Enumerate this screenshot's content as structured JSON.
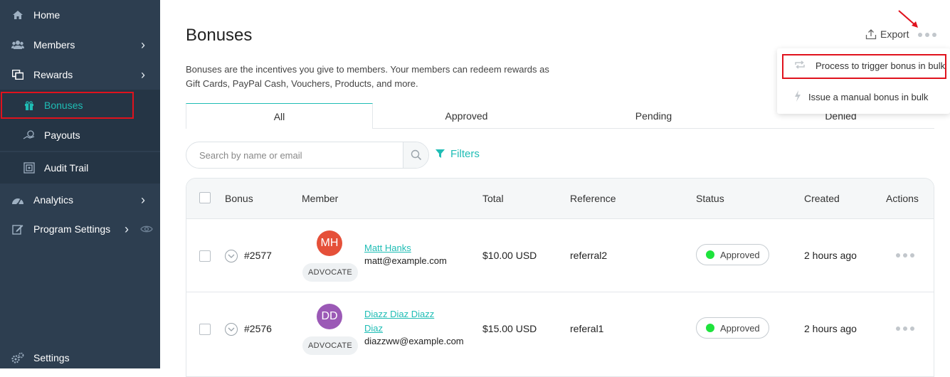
{
  "sidebar": {
    "items": [
      {
        "label": "Home",
        "icon": "home-icon"
      },
      {
        "label": "Members",
        "icon": "members-icon"
      },
      {
        "label": "Rewards",
        "icon": "rewards-icon"
      },
      {
        "label": "Bonuses",
        "icon": "gift-icon"
      },
      {
        "label": "Payouts",
        "icon": "payouts-icon"
      },
      {
        "label": "Audit Trail",
        "icon": "audit-icon"
      },
      {
        "label": "Analytics",
        "icon": "analytics-icon"
      },
      {
        "label": "Program Settings",
        "icon": "edit-icon"
      },
      {
        "label": "Settings",
        "icon": "settings-icon"
      }
    ]
  },
  "page": {
    "title": "Bonuses",
    "description_line1": "Bonuses are the incentives you give to members. Your members can redeem rewards as",
    "description_line2": "Gift Cards, PayPal Cash, Vouchers, Products, and more.",
    "export_label": "Export"
  },
  "tabs": [
    "All",
    "Approved",
    "Pending",
    "Denied"
  ],
  "search": {
    "placeholder": "Search by name or email"
  },
  "filters_label": "Filters",
  "table": {
    "headers": [
      "Bonus",
      "Member",
      "Total",
      "Reference",
      "Status",
      "Created",
      "Actions"
    ],
    "rows": [
      {
        "id": "#2577",
        "initials": "MH",
        "avatar_color": "#e55039",
        "name_line1": "Matt Hanks",
        "name_line2": "",
        "email": "matt@example.com",
        "role": "ADVOCATE",
        "total": "$10.00 USD",
        "reference": "referral2",
        "status": "Approved",
        "created": "2 hours ago"
      },
      {
        "id": "#2576",
        "initials": "DD",
        "avatar_color": "#9b59b6",
        "name_line1": "Diazz Diaz Diazz",
        "name_line2": "Diaz",
        "email": "diazzww@example.com",
        "role": "ADVOCATE",
        "total": "$15.00 USD",
        "reference": "referal1",
        "status": "Approved",
        "created": "2 hours ago"
      }
    ]
  },
  "dropdown": {
    "items": [
      {
        "label": "Process to trigger bonus in bulk"
      },
      {
        "label": "Issue a manual bonus in bulk"
      }
    ]
  },
  "colors": {
    "sidebar_bg": "#2d3e50",
    "accent": "#1fbdb5",
    "highlight": "#e0121d",
    "status_green": "#1ee33c"
  }
}
